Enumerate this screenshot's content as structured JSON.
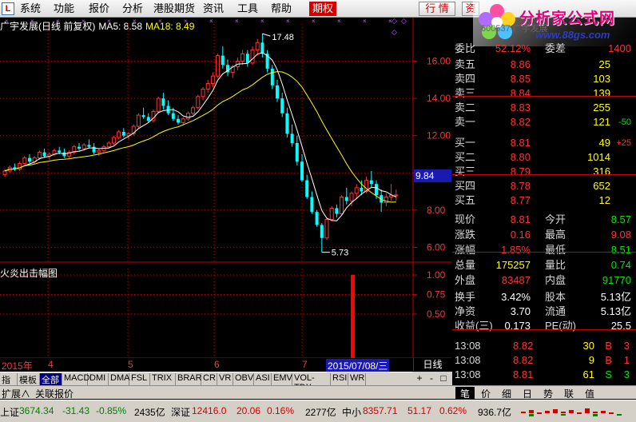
{
  "menu": {
    "items": [
      "系统",
      "功能",
      "报价",
      "分析",
      "港股期货",
      "资讯",
      "工具",
      "帮助",
      "期权"
    ],
    "quote_btn": "行 情",
    "info_btn": "资"
  },
  "brand": {
    "name": "分析家公式网",
    "url": "www.88gs.com",
    "watermark": "600537 广宇发展"
  },
  "chart": {
    "title": "广宇发展(日线 前复权)",
    "ma5_label": "MA5: 8.58",
    "ma18_label": "MA18: 8.49",
    "indicator_title": "火炎出击幅图",
    "price_axis": [
      "16.00",
      "14.00",
      "12.00",
      "10.00",
      "8.00",
      "6.00"
    ],
    "ind_axis": [
      "1.00",
      "0.75",
      "0.50"
    ],
    "current_price_tag": "9.84",
    "high_label": "17.48",
    "low_label": "5.73",
    "colors": {
      "up": "#ff3232",
      "down": "#00ffff",
      "ma5": "#ffffff",
      "ma18": "#ffff00",
      "grid": "#c80000"
    }
  },
  "chart_data": {
    "type": "candlestick",
    "title": "广宇发展(日线 前复权)",
    "ylim": [
      5.2,
      18.0
    ],
    "ma5_last": 8.58,
    "ma18_last": 8.49,
    "high": 17.48,
    "low": 5.73,
    "signal_bar": {
      "value": 1.0,
      "label": "2015/07/08/三"
    },
    "ohlc": [
      [
        9.9,
        10.2,
        9.8,
        10.1
      ],
      [
        10.1,
        10.4,
        10.0,
        10.3
      ],
      [
        10.3,
        10.5,
        10.1,
        10.2
      ],
      [
        10.2,
        10.6,
        10.1,
        10.5
      ],
      [
        10.5,
        10.9,
        10.4,
        10.8
      ],
      [
        10.8,
        11.0,
        10.5,
        10.6
      ],
      [
        10.6,
        10.9,
        10.5,
        10.8
      ],
      [
        10.8,
        11.2,
        10.7,
        11.1
      ],
      [
        11.1,
        11.3,
        10.8,
        10.9
      ],
      [
        10.9,
        11.1,
        10.7,
        11.0
      ],
      [
        11.0,
        11.3,
        10.9,
        11.2
      ],
      [
        11.2,
        11.4,
        11.0,
        11.1
      ],
      [
        11.1,
        11.3,
        10.8,
        10.9
      ],
      [
        10.9,
        11.2,
        10.8,
        11.1
      ],
      [
        11.1,
        11.5,
        11.0,
        11.4
      ],
      [
        11.4,
        11.6,
        11.2,
        11.3
      ],
      [
        11.3,
        11.6,
        11.2,
        11.5
      ],
      [
        11.5,
        11.8,
        11.3,
        11.4
      ],
      [
        11.4,
        11.6,
        11.0,
        11.1
      ],
      [
        11.1,
        11.3,
        10.9,
        11.2
      ],
      [
        11.2,
        11.5,
        11.1,
        11.4
      ],
      [
        11.4,
        11.7,
        11.3,
        11.6
      ],
      [
        11.6,
        12.0,
        11.5,
        11.9
      ],
      [
        11.9,
        12.3,
        11.8,
        12.2
      ],
      [
        12.2,
        12.4,
        11.9,
        12.0
      ],
      [
        12.0,
        12.2,
        11.8,
        12.1
      ],
      [
        12.1,
        12.6,
        12.0,
        12.5
      ],
      [
        12.5,
        13.2,
        12.4,
        13.1
      ],
      [
        13.1,
        13.5,
        12.9,
        13.0
      ],
      [
        13.0,
        13.2,
        12.7,
        12.8
      ],
      [
        12.8,
        13.4,
        12.7,
        13.3
      ],
      [
        13.3,
        14.1,
        13.2,
        14.0
      ],
      [
        14.0,
        14.3,
        13.4,
        13.6
      ],
      [
        13.6,
        13.9,
        13.1,
        13.2
      ],
      [
        13.2,
        13.5,
        12.8,
        12.9
      ],
      [
        12.9,
        13.1,
        12.6,
        12.7
      ],
      [
        12.7,
        13.0,
        12.6,
        12.9
      ],
      [
        12.9,
        13.3,
        12.8,
        13.2
      ],
      [
        13.2,
        13.6,
        13.1,
        13.5
      ],
      [
        13.5,
        14.2,
        13.4,
        14.1
      ],
      [
        14.1,
        14.6,
        13.9,
        14.5
      ],
      [
        14.5,
        15.0,
        14.3,
        14.8
      ],
      [
        14.8,
        15.4,
        14.6,
        15.2
      ],
      [
        15.2,
        16.4,
        15.1,
        16.3
      ],
      [
        16.3,
        16.8,
        15.6,
        15.8
      ],
      [
        15.8,
        16.1,
        15.2,
        15.4
      ],
      [
        15.4,
        15.8,
        15.1,
        15.7
      ],
      [
        15.7,
        16.2,
        15.5,
        16.0
      ],
      [
        16.0,
        16.6,
        15.8,
        16.4
      ],
      [
        16.4,
        16.6,
        15.7,
        15.9
      ],
      [
        15.9,
        16.8,
        15.8,
        16.6
      ],
      [
        16.6,
        17.2,
        16.3,
        17.0
      ],
      [
        17.0,
        17.48,
        16.2,
        16.4
      ],
      [
        16.4,
        16.6,
        15.4,
        15.6
      ],
      [
        15.6,
        15.8,
        14.5,
        14.7
      ],
      [
        14.7,
        15.0,
        13.8,
        14.0
      ],
      [
        14.0,
        14.3,
        13.0,
        13.2
      ],
      [
        13.2,
        13.5,
        11.9,
        12.1
      ],
      [
        12.1,
        12.6,
        11.4,
        11.6
      ],
      [
        11.6,
        12.0,
        10.4,
        10.6
      ],
      [
        10.6,
        11.0,
        9.5,
        9.6
      ],
      [
        9.6,
        9.9,
        8.6,
        8.7
      ],
      [
        8.7,
        9.0,
        7.8,
        7.9
      ],
      [
        7.9,
        8.0,
        7.1,
        7.2
      ],
      [
        7.2,
        7.3,
        5.73,
        6.5
      ],
      [
        6.5,
        7.6,
        6.4,
        7.5
      ],
      [
        7.5,
        8.2,
        7.4,
        8.1
      ],
      [
        8.1,
        8.3,
        7.6,
        7.8
      ],
      [
        7.8,
        8.8,
        7.7,
        8.7
      ],
      [
        8.7,
        9.2,
        8.3,
        8.5
      ],
      [
        8.5,
        9.0,
        8.2,
        8.9
      ],
      [
        8.9,
        9.4,
        8.6,
        9.2
      ],
      [
        9.2,
        9.6,
        8.8,
        9.0
      ],
      [
        9.0,
        9.8,
        8.9,
        9.6
      ],
      [
        9.6,
        10.1,
        9.2,
        9.4
      ],
      [
        9.4,
        9.6,
        8.6,
        8.8
      ],
      [
        8.8,
        9.1,
        7.9,
        8.4
      ],
      [
        8.4,
        8.9,
        8.2,
        8.7
      ],
      [
        8.7,
        9.4,
        8.5,
        8.8
      ],
      [
        8.8,
        9.1,
        8.5,
        8.81
      ]
    ]
  },
  "datebar": {
    "year": "2015年",
    "m4": "4",
    "m5": "5",
    "m6": "6",
    "m7": "7",
    "selected": "2015/07/08/三",
    "period": "日线"
  },
  "tabs": [
    "指标",
    "模板",
    "全部",
    "MACD",
    "DMI",
    "DMA",
    "FSL",
    "TRIX",
    "BRAR",
    "CR",
    "VR",
    "OBV",
    "ASI",
    "EMV",
    "VOL-TDX",
    "RSI",
    "WR"
  ],
  "zoom": [
    "+",
    "-",
    "□"
  ],
  "expand": {
    "label1": "扩展∧",
    "label2": "关联报价"
  },
  "panel": {
    "weibi_label": "委比",
    "weibi": "52.12%",
    "weicha_label": "委差",
    "weicha": "1400",
    "asks": [
      {
        "label": "卖五",
        "price": "8.86",
        "vol": "25",
        "chg": ""
      },
      {
        "label": "卖四",
        "price": "8.85",
        "vol": "103",
        "chg": ""
      },
      {
        "label": "卖三",
        "price": "8.84",
        "vol": "139",
        "chg": ""
      },
      {
        "label": "卖二",
        "price": "8.83",
        "vol": "255",
        "chg": ""
      },
      {
        "label": "卖一",
        "price": "8.82",
        "vol": "121",
        "chg": "-50"
      }
    ],
    "bids": [
      {
        "label": "买一",
        "price": "8.81",
        "vol": "49",
        "chg": "+25"
      },
      {
        "label": "买二",
        "price": "8.80",
        "vol": "1014",
        "chg": ""
      },
      {
        "label": "买三",
        "price": "8.79",
        "vol": "316",
        "chg": ""
      },
      {
        "label": "买四",
        "price": "8.78",
        "vol": "652",
        "chg": ""
      },
      {
        "label": "买五",
        "price": "8.77",
        "vol": "12",
        "chg": ""
      }
    ],
    "stats": [
      {
        "l1": "现价",
        "v1": "8.81",
        "c1": "red",
        "l2": "今开",
        "v2": "8.57",
        "c2": "green"
      },
      {
        "l1": "涨跌",
        "v1": "0.16",
        "c1": "red",
        "l2": "最高",
        "v2": "9.08",
        "c2": "red"
      },
      {
        "l1": "涨幅",
        "v1": "1.85%",
        "c1": "red",
        "l2": "最低",
        "v2": "8.51",
        "c2": "green"
      },
      {
        "l1": "总量",
        "v1": "175257",
        "c1": "yellow",
        "l2": "量比",
        "v2": "0.74",
        "c2": "green"
      },
      {
        "l1": "外盘",
        "v1": "83487",
        "c1": "red",
        "l2": "内盘",
        "v2": "91770",
        "c2": "green"
      }
    ],
    "fin": [
      {
        "l1": "换手",
        "v1": "3.42%",
        "l2": "股本",
        "v2": "5.13亿"
      },
      {
        "l1": "净资",
        "v1": "3.70",
        "l2": "流通",
        "v2": "5.13亿"
      },
      {
        "l1": "收益(三)",
        "v1": "0.173",
        "l2": "PE(动)",
        "v2": "25.5"
      }
    ],
    "ticks": [
      {
        "time": "13:08",
        "price": "8.82",
        "vol": "30",
        "bs": "B",
        "n": "3"
      },
      {
        "time": "13:08",
        "price": "8.82",
        "vol": "9",
        "bs": "B",
        "n": "1"
      },
      {
        "time": "13:08",
        "price": "8.81",
        "vol": "61",
        "bs": "S",
        "n": "3"
      }
    ]
  },
  "rtabs": [
    "笔",
    "价",
    "细",
    "日",
    "势",
    "联",
    "值"
  ],
  "status": {
    "sh_label": "上证",
    "sh_val": "3674.34",
    "sh_chg": "-31.43",
    "sh_pct": "-0.85%",
    "sh_amt": "2435亿",
    "sz_label": "深证",
    "sz_val": "12416.0",
    "sz_chg": "20.06",
    "sz_pct": "0.16%",
    "sz_amt": "2277亿",
    "zx_label": "中小",
    "zx_val": "8357.71",
    "zx_chg": "51.17",
    "zx_pct": "0.62%",
    "zx_amt": "936.7亿"
  }
}
